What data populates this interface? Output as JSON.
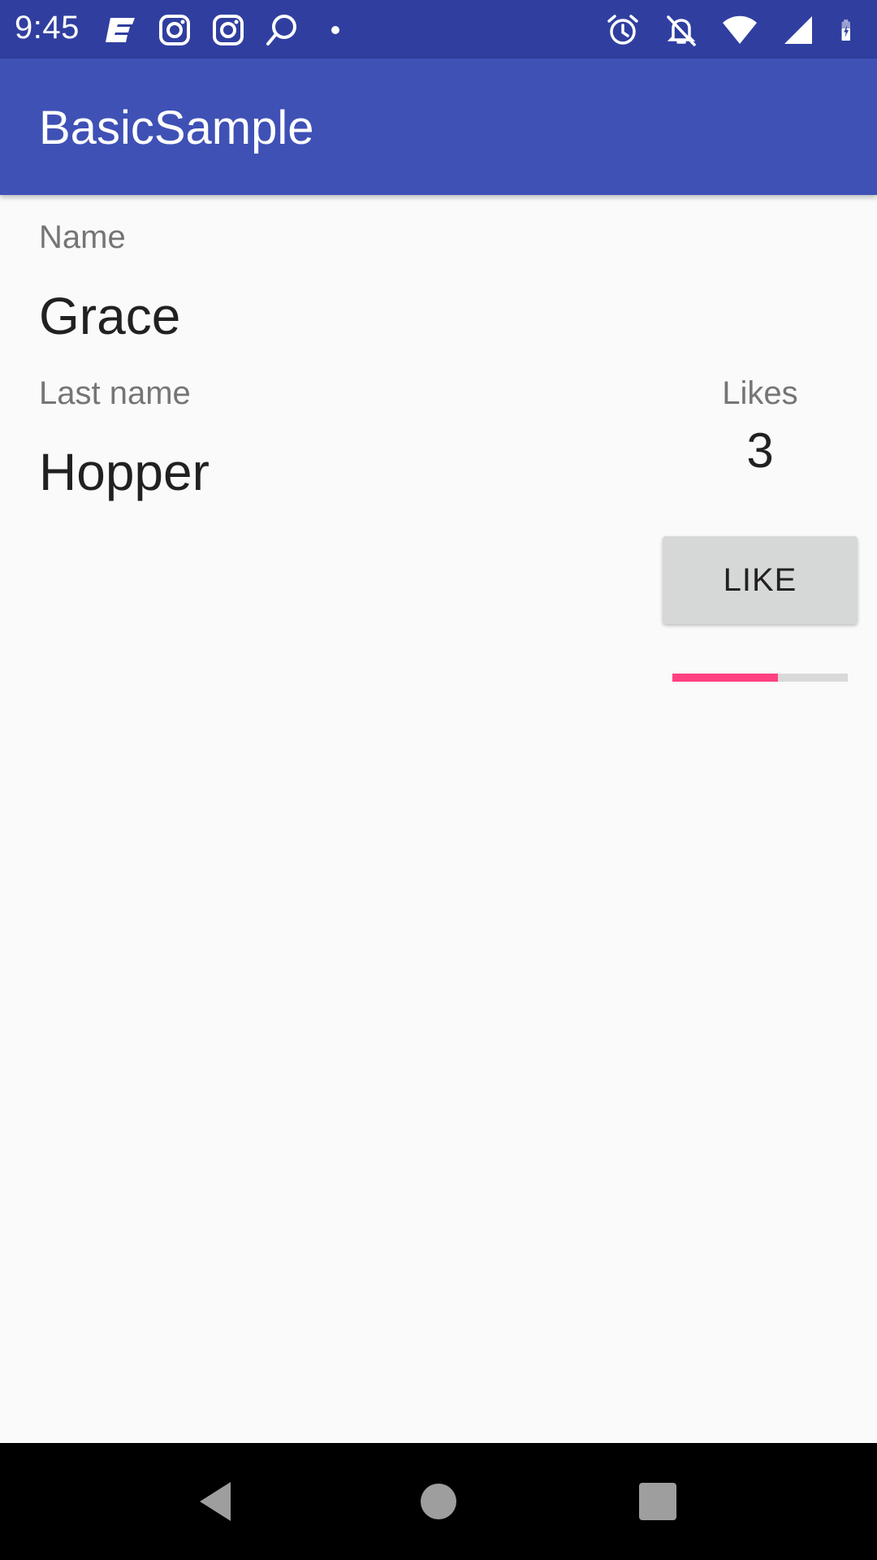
{
  "status_bar": {
    "time": "9:45",
    "left_icons": [
      "news-icon",
      "instagram-icon",
      "instagram-icon",
      "chat-icon",
      "dot-icon"
    ],
    "right_icons": [
      "alarm-icon",
      "notifications-off-icon",
      "wifi-icon",
      "signal-icon",
      "battery-charging-icon"
    ],
    "background": "#303f9f"
  },
  "app_bar": {
    "title": "BasicSample",
    "background": "#3f51b5"
  },
  "form": {
    "name_label": "Name",
    "name_value": "Grace",
    "last_name_label": "Last name",
    "last_name_value": "Hopper"
  },
  "likes": {
    "label": "Likes",
    "count": "3",
    "button_label": "LIKE",
    "progress_percent": 60,
    "progress_color": "#ff4081"
  },
  "nav_bar": {
    "buttons": [
      "back-icon",
      "home-icon",
      "recents-icon"
    ]
  }
}
